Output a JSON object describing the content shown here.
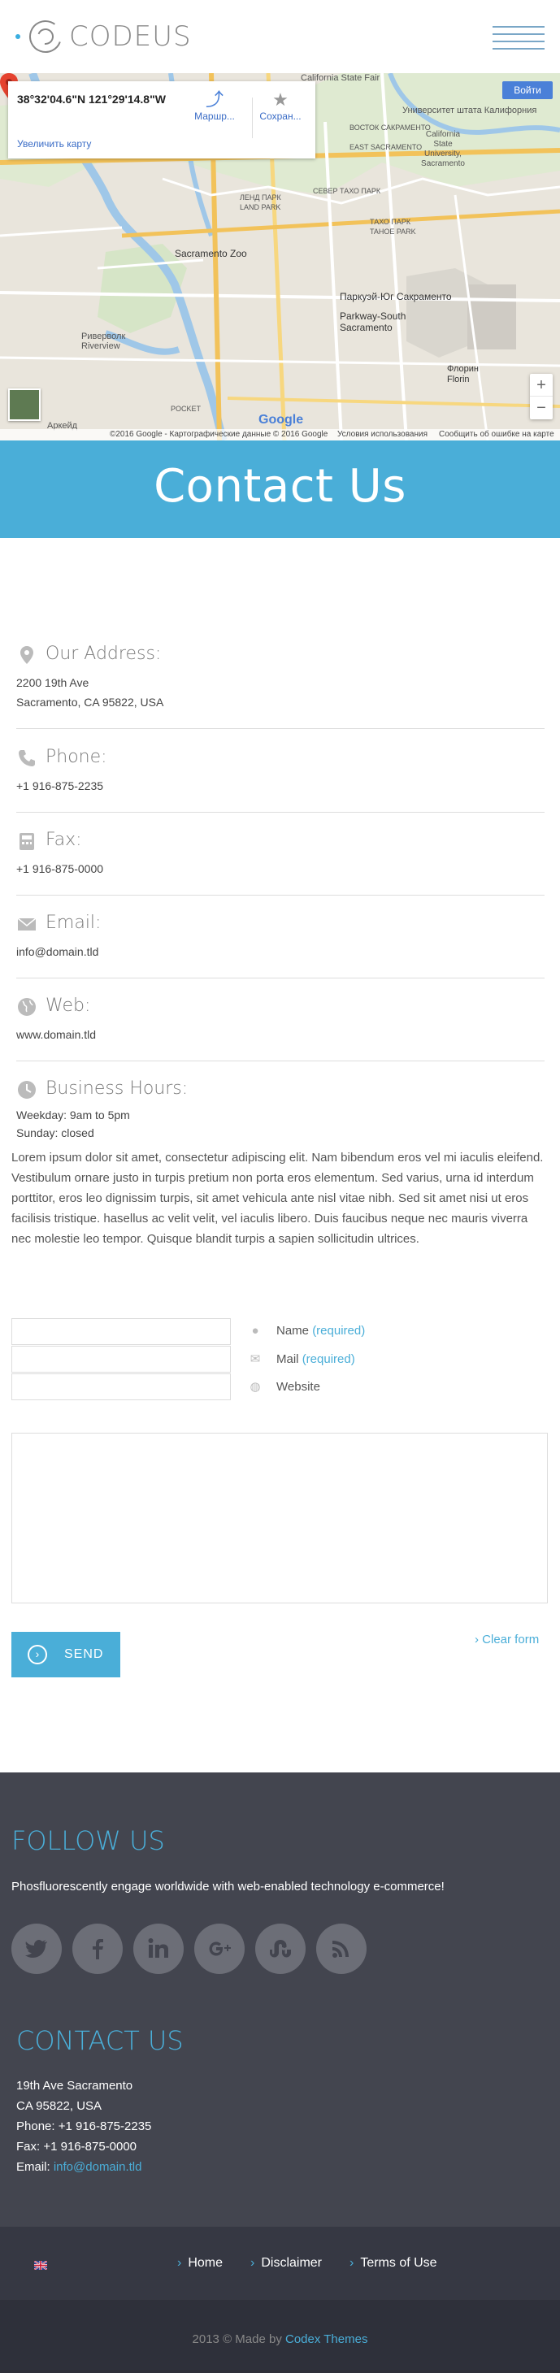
{
  "header": {
    "logo_text": "CODEUS"
  },
  "map": {
    "coords": "38°32'04.6\"N 121°29'14.8\"W",
    "route_label": "Маршр...",
    "save_label": "Сохран...",
    "enlarge_label": "Увеличить карту",
    "signin_label": "Войти",
    "zoom_in": "+",
    "zoom_out": "−",
    "google_logo": "Google",
    "footer": {
      "copyright": "©2016 Google - Картографические данные © 2016 Google",
      "terms": "Условия использования",
      "report": "Сообщить об ошибке на карте"
    },
    "labels": [
      "California State Fair",
      "Университет штата Калифорния",
      "California State University, Sacramento",
      "ВОСТОК САКРАМЕНТО",
      "EAST SACRAMENTO",
      "ЛЕНД ПАРК",
      "LAND PARK",
      "СЕВЕР ТАХО ПАРК",
      "ТАХО ПАРК",
      "TAHOE PARK",
      "Sacramento Zoo",
      "Паркуэй-Юг Сакраменто",
      "Parkway-South Sacramento",
      "Риверволк Riverview",
      "Флорин Florin",
      "POCKET",
      "Аркейд"
    ]
  },
  "hero": {
    "title": "Contact Us"
  },
  "contact": {
    "address": {
      "label": "Our Address:",
      "line1": "2200 19th Ave",
      "line2": "Sacramento, CA 95822, USA"
    },
    "phone": {
      "label": "Phone:",
      "value": "+1 916-875-2235"
    },
    "fax": {
      "label": "Fax:",
      "value": "+1 916-875-0000"
    },
    "email": {
      "label": "Email:",
      "value": "info@domain.tld"
    },
    "web": {
      "label": "Web:",
      "value": "www.domain.tld"
    },
    "hours": {
      "label": "Business Hours:",
      "line1": "Weekday: 9am to 5pm",
      "line2": "Sunday: closed"
    }
  },
  "lorem": "Lorem ipsum dolor sit amet, consectetur adipiscing elit. Nam bibendum eros vel mi iaculis eleifend. Vestibulum ornare justo in turpis pretium non porta eros elementum. Sed varius, urna id interdum porttitor, eros leo dignissim turpis, sit amet vehicula ante nisl vitae nibh. Sed sit amet nisi ut eros facilisis tristique. hasellus ac velit velit, vel iaculis libero. Duis faucibus neque nec mauris viverra nec molestie leo tempor.  Quisque blandit turpis a sapien sollicitudin ultrices.",
  "form": {
    "name_label": "Name",
    "mail_label": "Mail",
    "website_label": "Website",
    "required": "(required)",
    "send_label": "SEND",
    "clear_label": "Clear form"
  },
  "footer": {
    "follow_title": "FOLLOW US",
    "follow_text": "Phosfluorescently engage worldwide with web-enabled technology e-commerce!",
    "social": [
      "twitter-icon",
      "facebook-icon",
      "linkedin-icon",
      "google-plus-icon",
      "stumbleupon-icon",
      "rss-icon"
    ],
    "contact_title": "CONTACT US",
    "contact_line1": "19th Ave Sacramento",
    "contact_line2": "CA 95822, USA",
    "contact_phone": "Phone: +1 916-875-2235",
    "contact_fax": "Fax: +1 916-875-0000",
    "contact_email_prefix": "Email: ",
    "contact_email": "info@domain.tld",
    "nav": [
      "Home",
      "Disclaimer",
      "Terms of Use"
    ],
    "copyright_prefix": "2013 © Made by ",
    "copyright_brand": "Codex Themes"
  },
  "colors": {
    "accent": "#4aaed8",
    "footer_bg": "#43454f",
    "nav_bg": "#363843",
    "copy_bg": "#2e303a"
  }
}
